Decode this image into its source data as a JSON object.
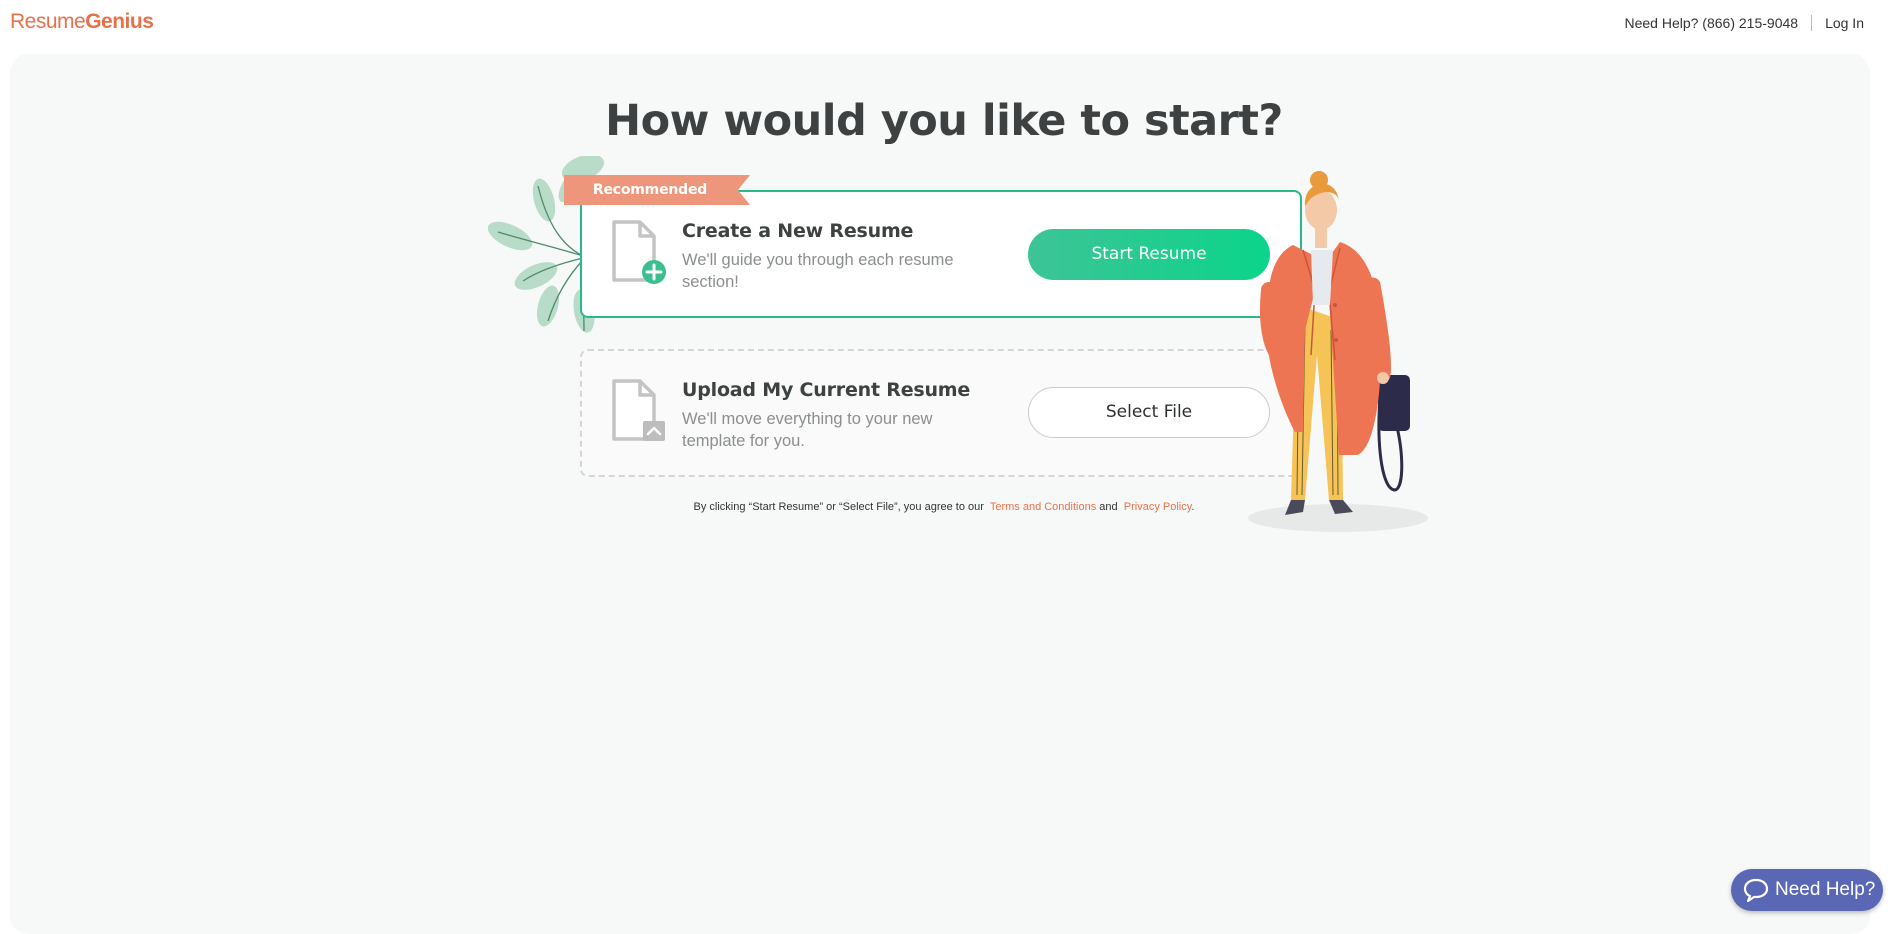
{
  "header": {
    "logo_part1": "Resume",
    "logo_part2": "Genius",
    "phone": "Need Help? (866) 215-9048",
    "login": "Log In"
  },
  "main": {
    "title": "How would you like to start?",
    "ribbon": "Recommended",
    "create": {
      "title": "Create a New Resume",
      "description": "We'll guide you through each resume section!",
      "button": "Start Resume",
      "icon": "document-plus-icon"
    },
    "upload": {
      "title": "Upload My Current Resume",
      "description": "We'll move everything to your new template for you.",
      "button": "Select File",
      "icon": "document-upload-icon"
    },
    "agreement": {
      "text": "By clicking “Start Resume” or “Select File”, you agree to our",
      "terms": "Terms and Conditions",
      "and": "and",
      "privacy": "Privacy Policy",
      "period": "."
    }
  },
  "chat": {
    "label": "Need Help?",
    "icon": "chat-bubble-icon"
  },
  "colors": {
    "brand": "#e8714a",
    "accent_green": "#28b98a",
    "chat": "#5a67b4",
    "ribbon": "#ee967b"
  }
}
